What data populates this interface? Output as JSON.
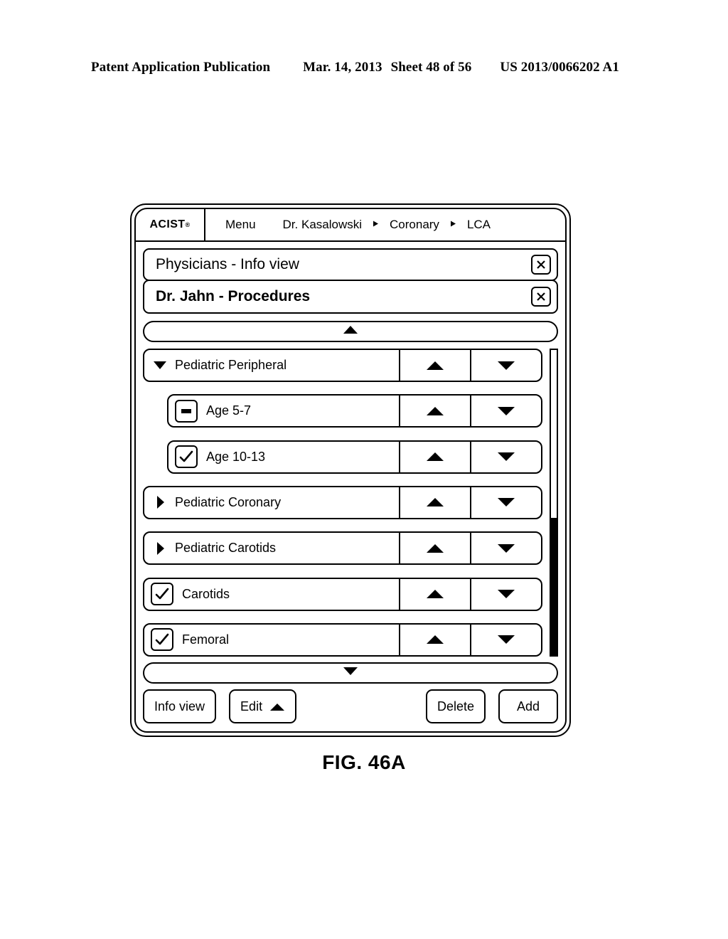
{
  "page_header": {
    "publication": "Patent Application Publication",
    "date": "Mar. 14, 2013",
    "sheet": "Sheet 48 of 56",
    "patent_number": "US 2013/0066202 A1"
  },
  "figure_caption": "FIG. 46A",
  "topbar": {
    "brand": "ACIST",
    "brand_mark": "®",
    "menu_label": "Menu",
    "breadcrumb": [
      {
        "label": "Dr. Kasalowski",
        "icon": "breadcrumb-arrow-icon"
      },
      {
        "label": "Coronary",
        "icon": "breadcrumb-arrow-icon"
      },
      {
        "label": "LCA",
        "icon": null
      }
    ]
  },
  "panels": [
    {
      "title": "Physicians - Info view",
      "bold": false,
      "close_icon": "close-x-icon"
    },
    {
      "title": "Dr. Jahn - Procedures",
      "bold": true,
      "close_icon": "close-x-icon"
    }
  ],
  "scroll": {
    "up_icon": "scroll-up-triangle-icon",
    "down_icon": "scroll-down-triangle-icon",
    "vertical_thumb_position": "lower"
  },
  "list": {
    "move_up_icon": "move-up-arrow-icon",
    "move_down_icon": "move-down-arrow-icon",
    "rows": [
      {
        "label": "Pediatric Peripheral",
        "marker": "triangle-down",
        "marker_icon": "expanded-triangle-icon",
        "indent": false,
        "checkbox": null
      },
      {
        "label": "Age 5-7",
        "marker": "checkbox",
        "marker_icon": "checkbox-partial-icon",
        "indent": true,
        "checkbox": "partial"
      },
      {
        "label": "Age 10-13",
        "marker": "checkbox",
        "marker_icon": "checkbox-checked-icon",
        "indent": true,
        "checkbox": "checked"
      },
      {
        "label": "Pediatric Coronary",
        "marker": "triangle-right",
        "marker_icon": "collapsed-triangle-icon",
        "indent": false,
        "checkbox": null
      },
      {
        "label": "Pediatric Carotids",
        "marker": "triangle-right",
        "marker_icon": "collapsed-triangle-icon",
        "indent": false,
        "checkbox": null
      },
      {
        "label": "Carotids",
        "marker": "checkbox",
        "marker_icon": "checkbox-checked-icon",
        "indent": false,
        "checkbox": "checked"
      },
      {
        "label": "Femoral",
        "marker": "checkbox",
        "marker_icon": "checkbox-checked-icon",
        "indent": false,
        "checkbox": "checked"
      }
    ]
  },
  "footer": {
    "info_view": "Info view",
    "edit": "Edit",
    "edit_icon": "caret-up-icon",
    "delete": "Delete",
    "add": "Add"
  },
  "colors": {
    "ink": "#000000",
    "paper": "#ffffff"
  }
}
